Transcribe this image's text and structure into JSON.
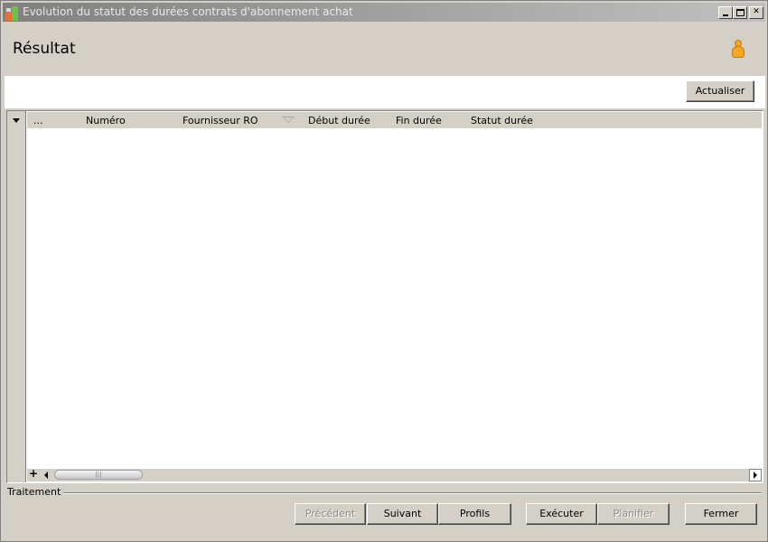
{
  "window": {
    "title": "Evolution du statut des durées contrats d'abonnement achat",
    "minimize": "_",
    "maximize": "□",
    "close": "✕"
  },
  "header": {
    "title": "Résultat",
    "user_icon": "user-icon"
  },
  "toolbar": {
    "refresh_label": "Actualiser"
  },
  "grid": {
    "columns": [
      {
        "label": "..."
      },
      {
        "label": "Numéro"
      },
      {
        "label": "Fournisseur RO"
      },
      {
        "label": "Début durée"
      },
      {
        "label": "Fin durée"
      },
      {
        "label": "Statut durée"
      }
    ],
    "rows": [],
    "add_symbol": "+",
    "scroll_grip": "|||"
  },
  "footer": {
    "section_label": "Traitement",
    "buttons": {
      "previous": "Précédent",
      "next": "Suivant",
      "profiles": "Profils",
      "execute": "Exécuter",
      "schedule": "Planifier",
      "close": "Fermer"
    },
    "disabled": [
      "previous",
      "schedule"
    ]
  }
}
